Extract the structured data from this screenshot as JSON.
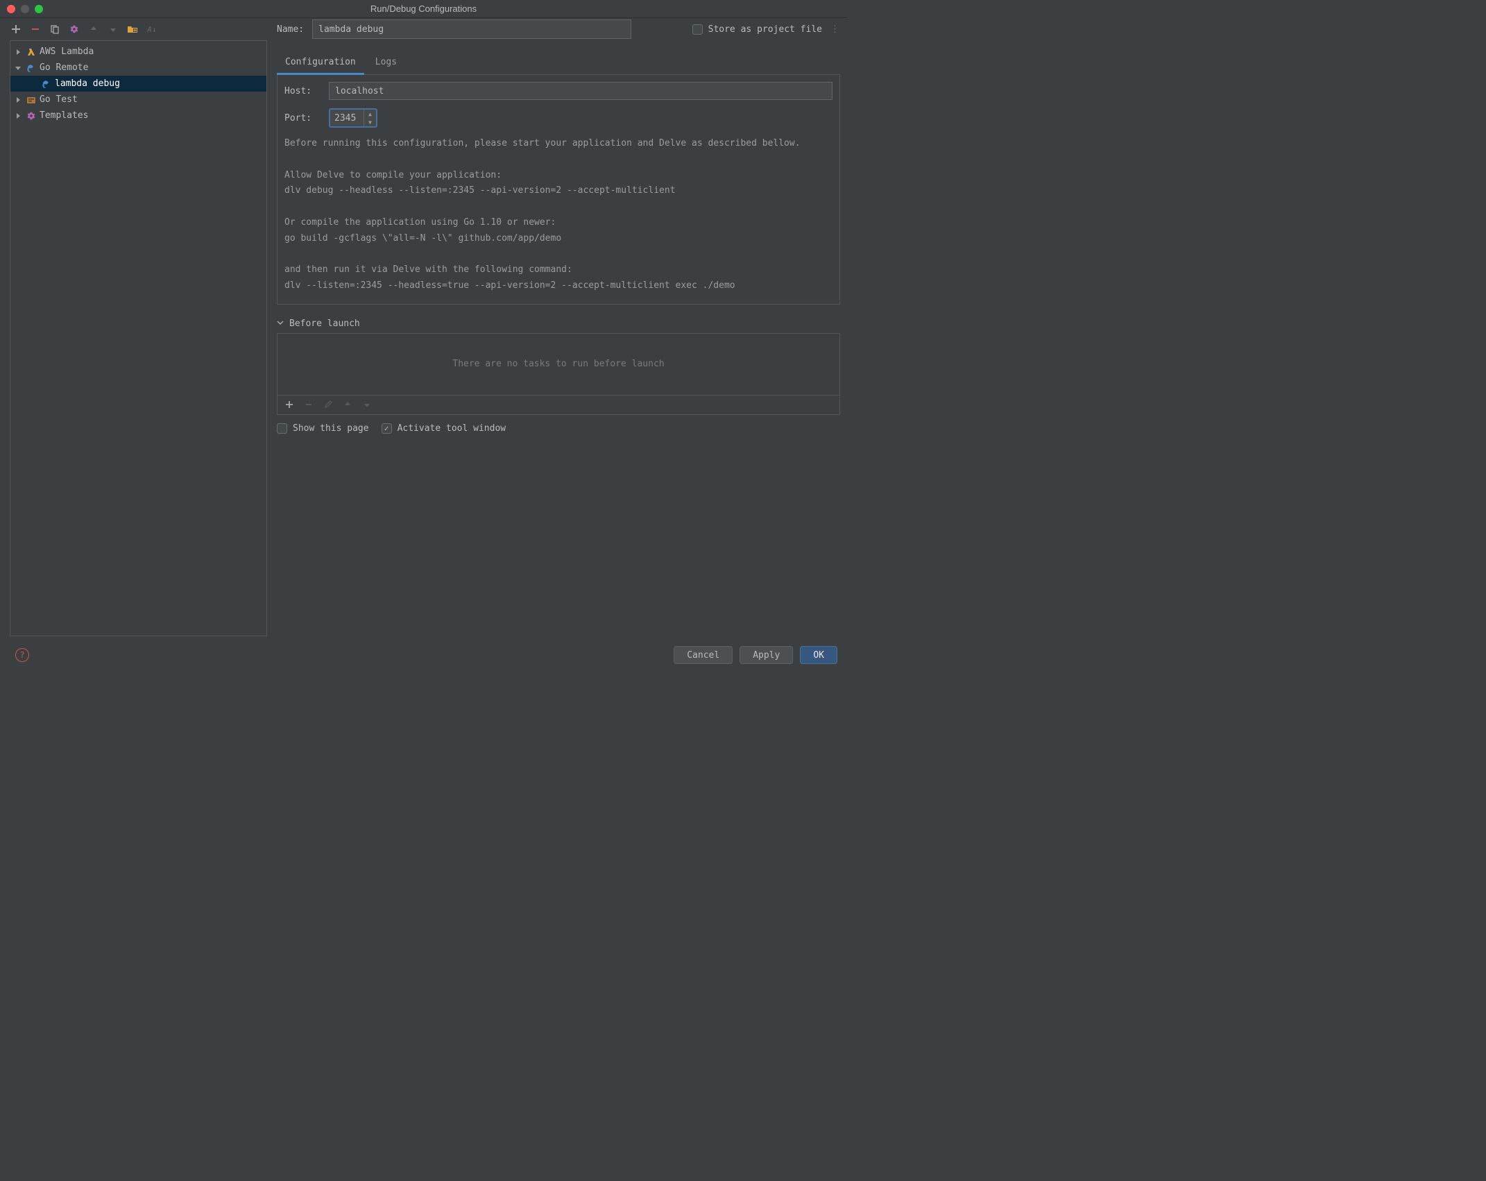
{
  "window": {
    "title": "Run/Debug Configurations"
  },
  "name_row": {
    "label": "Name:",
    "value": "lambda debug"
  },
  "store": {
    "label": "Store as project file"
  },
  "tree": {
    "items": [
      {
        "label": "AWS Lambda"
      },
      {
        "label": "Go Remote"
      },
      {
        "label": "lambda debug"
      },
      {
        "label": "Go Test"
      },
      {
        "label": "Templates"
      }
    ]
  },
  "tabs": {
    "configuration": "Configuration",
    "logs": "Logs"
  },
  "form": {
    "host_label": "Host:",
    "host_value": "localhost",
    "port_label": "Port:",
    "port_value": "2345"
  },
  "instructions": {
    "l1": "Before running this configuration, please start your application and Delve as described bellow.",
    "l2": "Allow Delve to compile your application:",
    "l3": "dlv debug --headless --listen=:2345 --api-version=2 --accept-multiclient",
    "l4": "Or compile the application using Go 1.10 or newer:",
    "l5": "go build -gcflags \\\"all=-N -l\\\" github.com/app/demo",
    "l6": "and then run it via Delve with the following command:",
    "l7": "dlv --listen=:2345 --headless=true --api-version=2 --accept-multiclient exec ./demo"
  },
  "before_launch": {
    "header": "Before launch",
    "empty": "There are no tasks to run before launch"
  },
  "checks": {
    "show_page": "Show this page",
    "activate": "Activate tool window"
  },
  "buttons": {
    "cancel": "Cancel",
    "apply": "Apply",
    "ok": "OK"
  }
}
